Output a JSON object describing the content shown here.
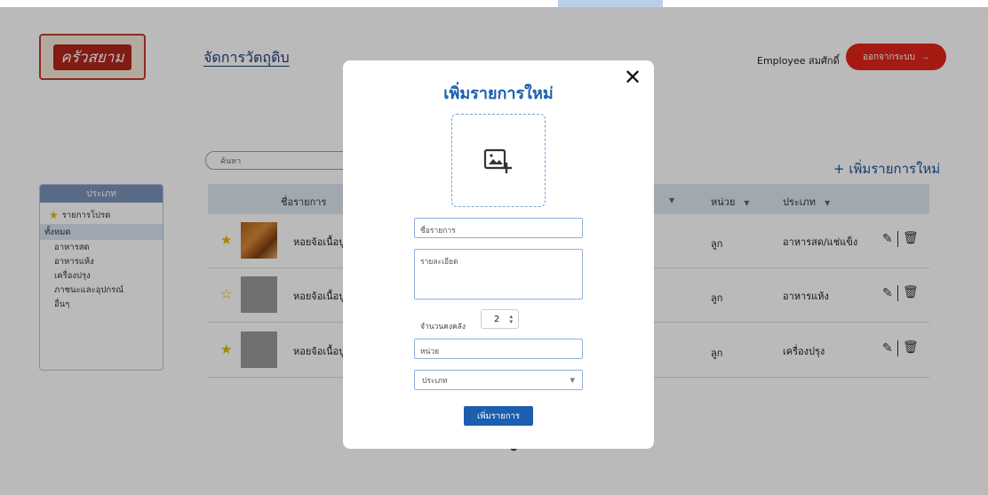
{
  "app": {
    "logo_text": "ครัวสยาม",
    "page_title": "จัดการวัตถุดิบ",
    "user_name": "Employee สมศักดิ์",
    "logout_label": "ออกจากระบบ",
    "logout_icon": "arrow-right-icon"
  },
  "search": {
    "placeholder": "ค้นหา"
  },
  "add_new_label": "+ เพิ่มรายการใหม่",
  "sidebar": {
    "header": "ประเภท",
    "favorites": "รายการโปรด",
    "all": "ทั้งหมด",
    "categories": [
      "อาหารสด",
      "อาหารแห้ง",
      "เครื่องปรุง",
      "ภาชนะและอุปกรณ์",
      "อื่นๆ"
    ]
  },
  "table": {
    "headers": {
      "name": "ชื่อรายการ",
      "unit": "หน่วย",
      "type": "ประเภท"
    },
    "rows": [
      {
        "favorite": true,
        "image": "food-photo",
        "name": "หอยจ้อเนื้อปู",
        "unit": "ลูก",
        "type": "อาหารสด/แช่แข็ง"
      },
      {
        "favorite": false,
        "image": "placeholder",
        "name": "หอยจ้อเนื้อปู",
        "unit": "ลูก",
        "type": "อาหารแห้ง"
      },
      {
        "favorite": true,
        "image": "placeholder",
        "name": "หอยจ้อเนื้อปู",
        "unit": "ลูก",
        "type": "เครื่องปรุง"
      }
    ]
  },
  "modal": {
    "title": "เพิ่มรายการใหม่",
    "close_label": "✕",
    "upload_icon": "add-image-icon",
    "name_placeholder": "ชื่อรายการ",
    "detail_placeholder": "รายละเอียด",
    "qty_label": "จำนวนคงคลัง",
    "qty_value": "2",
    "unit_placeholder": "หน่วย",
    "type_placeholder": "ประเภท",
    "submit_label": "เพิ่มรายการ"
  },
  "colors": {
    "primary_blue": "#1b5fae",
    "logout_red": "#e3261c",
    "star_gold": "#e6b800"
  }
}
